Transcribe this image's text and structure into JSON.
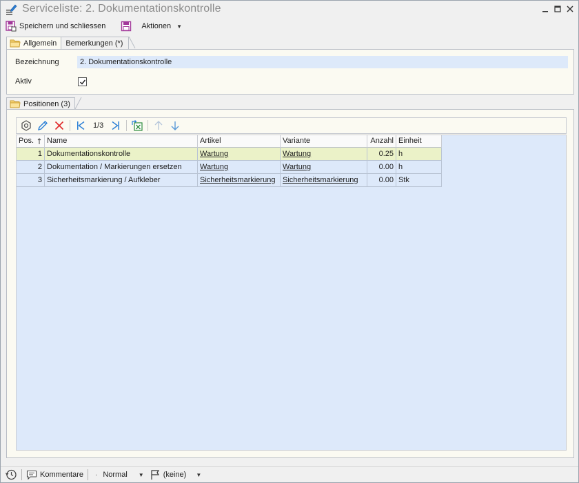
{
  "window": {
    "title": "Serviceliste: 2. Dokumentationskontrolle",
    "controls": {
      "minimize": "_",
      "maximize": "☐",
      "close": "✕"
    }
  },
  "toolbar": {
    "save_close_label": "Speichern und schliessen",
    "actions_label": "Aktionen"
  },
  "tabs_top": [
    {
      "label": "Allgemein",
      "active": true
    },
    {
      "label": "Bemerkungen (*)",
      "active": false
    }
  ],
  "general": {
    "bezeichnung_label": "Bezeichnung",
    "bezeichnung_value": "2. Dokumentationskontrolle",
    "aktiv_label": "Aktiv",
    "aktiv_checked": true
  },
  "positions_tab": {
    "label": "Positionen (3)"
  },
  "grid_toolbar": {
    "page": "1/3"
  },
  "grid": {
    "columns": [
      "Pos.",
      "Name",
      "Artikel",
      "Variante",
      "Anzahl",
      "Einheit"
    ],
    "rows": [
      {
        "pos": "1",
        "name": "Dokumentationskontrolle",
        "artikel": "Wartung",
        "variante": "Wartung",
        "anzahl": "0.25",
        "einheit": "h"
      },
      {
        "pos": "2",
        "name": "Dokumentation / Markierungen ersetzen",
        "artikel": "Wartung",
        "variante": "Wartung",
        "anzahl": "0.00",
        "einheit": "h"
      },
      {
        "pos": "3",
        "name": "Sicherheitsmarkierung / Aufkleber",
        "artikel": "Sicherheitsmarkierung",
        "variante": "Sicherheitsmarkierung",
        "anzahl": "0.00",
        "einheit": "Stk"
      }
    ],
    "selected_row_index": 0
  },
  "statusbar": {
    "comments_label": "Kommentare",
    "priority_label": "Normal",
    "flag_label": "(keine)"
  },
  "colors": {
    "input_bg": "#dde9fa",
    "panel_bg": "#fbfaf2",
    "selected_row": "#ebf2c8",
    "icon_blue": "#2a7fd6",
    "icon_red": "#e02a2a",
    "icon_magenta": "#a2389a"
  }
}
